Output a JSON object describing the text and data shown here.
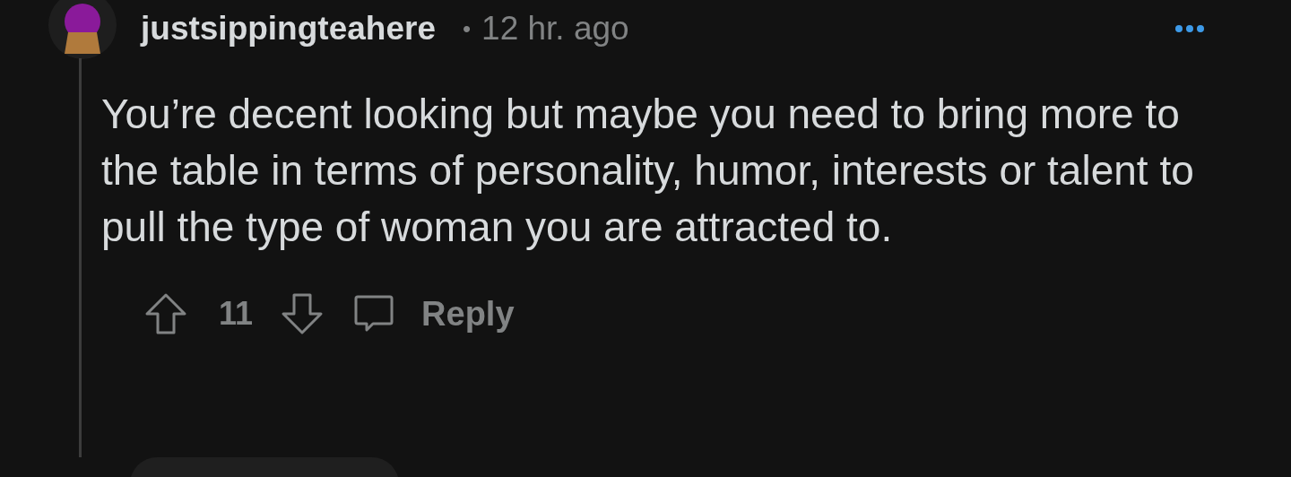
{
  "comment": {
    "author": "justsippingteahere",
    "separator": "•",
    "time": "12 hr. ago",
    "body": "You’re decent looking but maybe you need to bring more to the table in terms of personality, humor, interests or talent to pull the type of woman you are attracted to.",
    "score": "11",
    "reply_label": "Reply"
  }
}
